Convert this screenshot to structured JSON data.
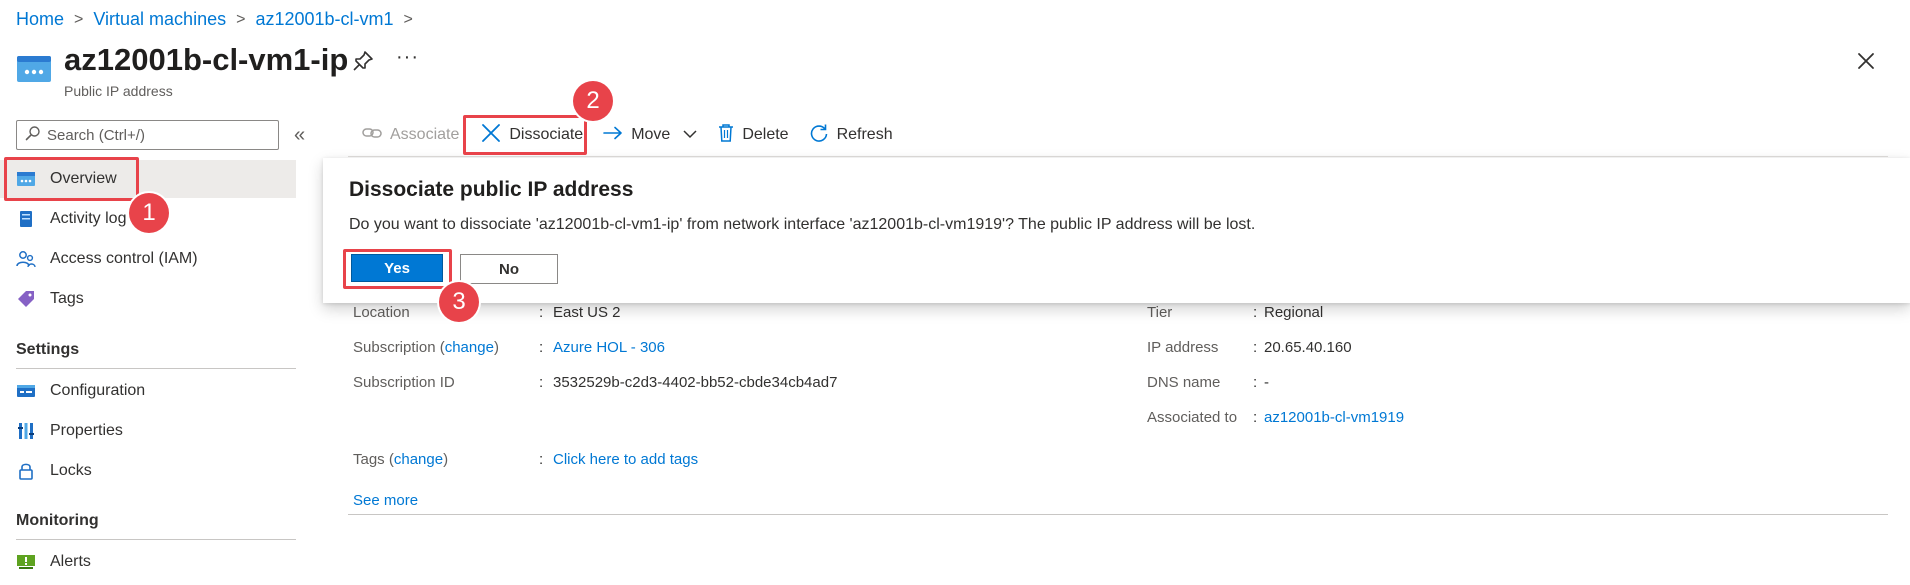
{
  "breadcrumb": {
    "items": [
      "Home",
      "Virtual machines",
      "az12001b-cl-vm1"
    ],
    "separator": ">"
  },
  "header": {
    "title": "az12001b-cl-vm1-ip",
    "subtitle": "Public IP address",
    "more": "···",
    "icon": "public-ip-icon"
  },
  "search": {
    "placeholder": "Search (Ctrl+/)",
    "collapse": "«"
  },
  "sidebar": {
    "items": [
      {
        "label": "Overview",
        "icon": "overview-icon",
        "active": true
      },
      {
        "label": "Activity log",
        "icon": "activity-log-icon"
      },
      {
        "label": "Access control (IAM)",
        "icon": "iam-icon"
      },
      {
        "label": "Tags",
        "icon": "tag-icon"
      }
    ],
    "sections": [
      {
        "title": "Settings",
        "items": [
          {
            "label": "Configuration",
            "icon": "configuration-icon"
          },
          {
            "label": "Properties",
            "icon": "properties-icon"
          },
          {
            "label": "Locks",
            "icon": "lock-icon"
          }
        ]
      },
      {
        "title": "Monitoring",
        "items": [
          {
            "label": "Alerts",
            "icon": "alerts-icon"
          }
        ]
      }
    ]
  },
  "toolbar": {
    "associate": "Associate",
    "dissociate": "Dissociate",
    "move": "Move",
    "delete": "Delete",
    "refresh": "Refresh"
  },
  "dialog": {
    "title": "Dissociate public IP address",
    "message": "Do you want to dissociate 'az12001b-cl-vm1-ip' from network interface 'az12001b-cl-vm1919'? The public IP address will be lost.",
    "yes": "Yes",
    "no": "No"
  },
  "essentials": {
    "left": {
      "location": {
        "label": "Location",
        "value": "East US 2"
      },
      "subscription": {
        "label_prefix": "Subscription (",
        "label_link": "change",
        "label_suffix": ")",
        "value": "Azure HOL - 306"
      },
      "subscription_id": {
        "label": "Subscription ID",
        "value": "3532529b-c2d3-4402-bb52-cbde34cb4ad7"
      },
      "tags": {
        "label_prefix": "Tags (",
        "label_link": "change",
        "label_suffix": ")",
        "value": "Click here to add tags"
      }
    },
    "right": {
      "tier": {
        "label": "Tier",
        "value": "Regional"
      },
      "ip_address": {
        "label": "IP address",
        "value": "20.65.40.160"
      },
      "dns_name": {
        "label": "DNS name",
        "value": "-"
      },
      "associated_to": {
        "label": "Associated to",
        "value": "az12001b-cl-vm1919"
      }
    },
    "colon": ":",
    "see_more": "See more"
  },
  "callouts": {
    "badge1": "1",
    "badge2": "2",
    "badge3": "3",
    "color": "#e8434a"
  },
  "colors": {
    "accent": "#0078d4",
    "callout": "#e8434a"
  }
}
